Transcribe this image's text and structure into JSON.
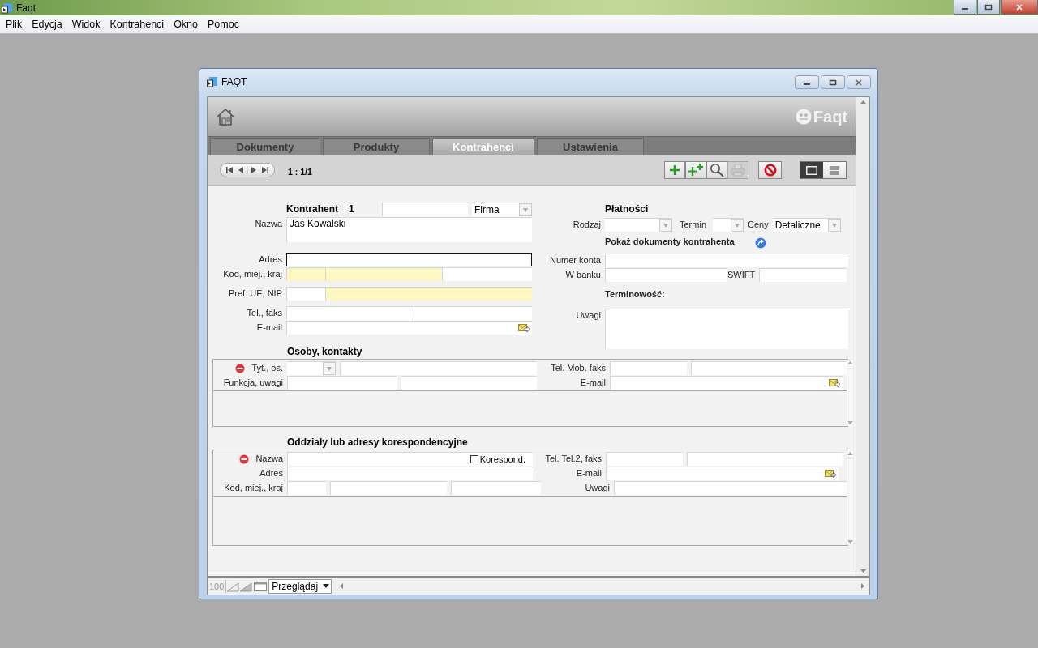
{
  "app": {
    "title": "Faqt"
  },
  "menu": [
    {
      "label": "Plik"
    },
    {
      "label": "Edycja"
    },
    {
      "label": "Widok"
    },
    {
      "label": "Kontrahenci"
    },
    {
      "label": "Okno"
    },
    {
      "label": "Pomoc"
    }
  ],
  "window": {
    "title": "FAQT",
    "logo": "Faqt"
  },
  "tabs": [
    {
      "label": "Dokumenty",
      "selected": false
    },
    {
      "label": "Produkty",
      "selected": false
    },
    {
      "label": "Kontrahenci",
      "selected": true
    },
    {
      "label": "Ustawienia",
      "selected": false
    }
  ],
  "toolbar": {
    "counter": "1 : 1/1",
    "actions": [
      {
        "kind": "add",
        "disabled": false
      },
      {
        "kind": "add_multiple",
        "disabled": false
      },
      {
        "kind": "find",
        "disabled": false
      },
      {
        "kind": "print",
        "disabled": true
      },
      {
        "kind": "delete",
        "disabled": false
      }
    ],
    "views": [
      {
        "kind": "form",
        "selected": true
      },
      {
        "kind": "list",
        "selected": false
      }
    ]
  },
  "contractor": {
    "heading": "Kontrahent",
    "number": "1",
    "type": "Firma",
    "fields": [
      {
        "label": "Nazwa",
        "kind": "name",
        "value": "Jaś Kowalski",
        "focused": false,
        "segments": [
          {
            "highlighted": false
          }
        ]
      },
      {
        "label": "Adres",
        "kind": "address",
        "focused": true,
        "segments": [
          {
            "highlighted": false
          }
        ]
      },
      {
        "label": "Kod, miej., kraj",
        "kind": "postal",
        "focused": false,
        "segments": [
          {
            "highlighted": true
          },
          {
            "highlighted": true
          },
          {
            "highlighted": false
          }
        ]
      },
      {
        "label": "Pref. UE, NIP",
        "kind": "vat",
        "focused": false,
        "segments": [
          {
            "highlighted": false
          },
          {
            "highlighted": true
          }
        ]
      },
      {
        "label": "Tel., faks",
        "kind": "phone",
        "focused": false,
        "segments": [
          {
            "highlighted": false
          },
          {
            "highlighted": false
          }
        ]
      },
      {
        "label": "E-mail",
        "kind": "email",
        "focused": false,
        "segments": [
          {
            "highlighted": false
          }
        ]
      }
    ]
  },
  "payments": {
    "heading": "Płatności",
    "method_label": "Rodzaj",
    "term_label": "Termin",
    "prices_label": "Ceny",
    "prices_value": "Detaliczne",
    "documents_link": "Pokaż dokumenty kontrahenta",
    "account_label": "Numer konta",
    "bank_label": "W banku",
    "swift_label": "SWIFT",
    "punctuality_label": "Terminowość:",
    "notes_label": "Uwagi"
  },
  "contacts": {
    "heading": "Osoby, kontakty",
    "title_label": "Tyt., os.",
    "function_label": "Funkcja, uwagi",
    "phone_label": "Tel. Mob. faks",
    "email_label": "E-mail"
  },
  "branches": {
    "heading": "Oddziały lub adresy korespondencyjne",
    "name_label": "Nazwa",
    "correspondence_label": "Korespond.",
    "correspondence_checked": false,
    "address_label": "Adres",
    "postal_label": "Kod, miej., kraj",
    "phone_label": "Tel. Tel.2, faks",
    "email_label": "E-mail",
    "notes_label": "Uwagi"
  },
  "status_bar": {
    "zoom": "100",
    "mode": "Przeglądaj"
  }
}
